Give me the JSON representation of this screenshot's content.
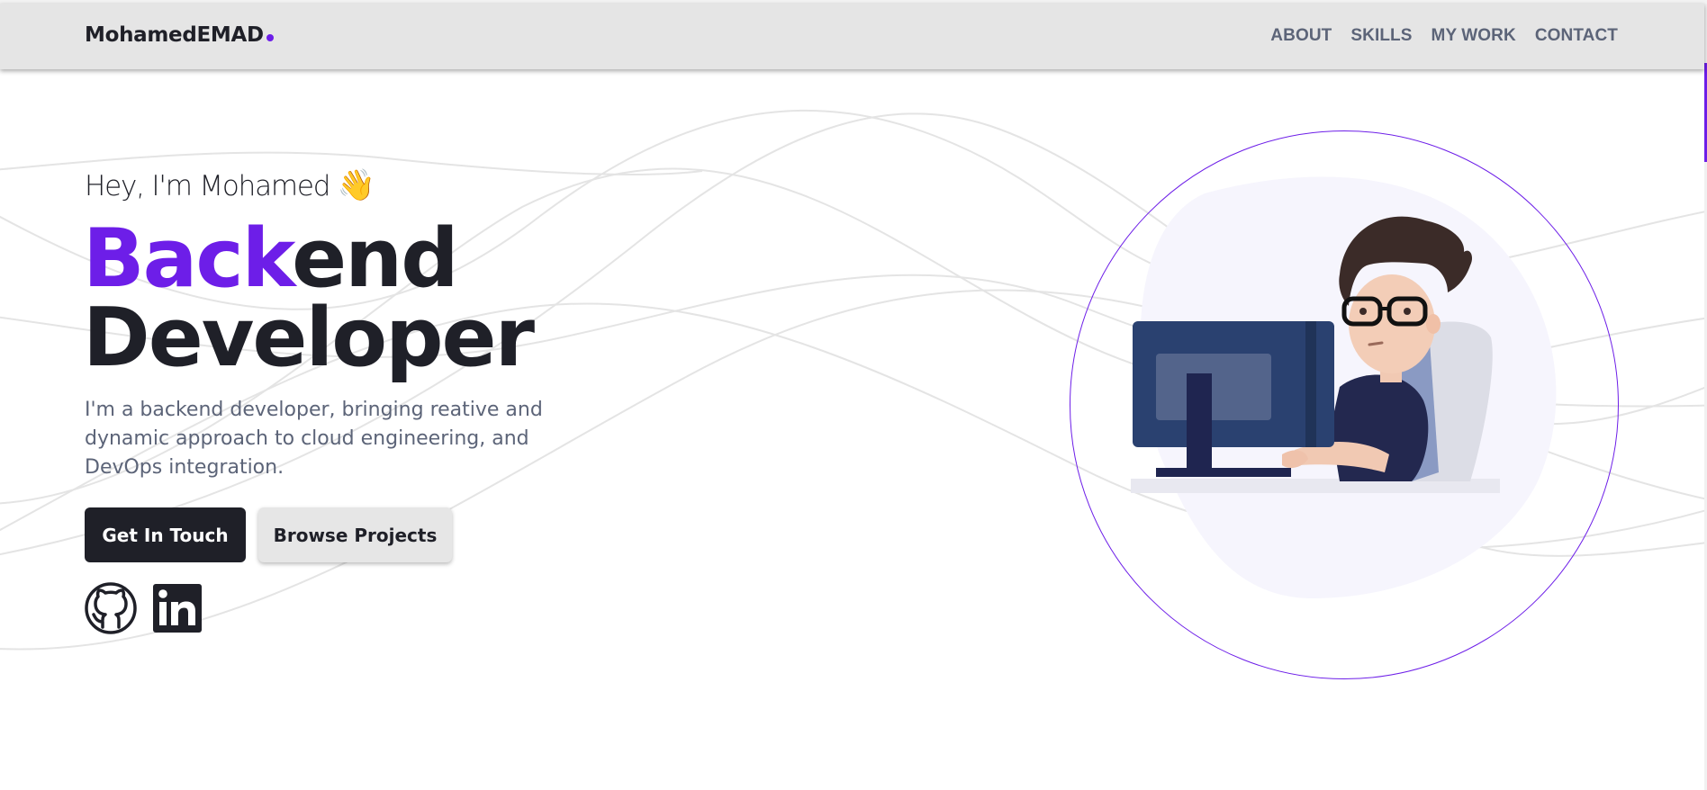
{
  "header": {
    "logo": "MohamedEMAD",
    "nav": [
      "ABOUT",
      "SKILLS",
      "MY WORK",
      "CONTACT"
    ]
  },
  "hero": {
    "greeting": "Hey, I'm Mohamed",
    "greeting_emoji": "👋",
    "title_accent": "Back",
    "title_rest": "end",
    "title_line2": "Developer",
    "intro": "I'm a backend developer, bringing reative and dynamic approach to cloud engineering, and DevOps integration.",
    "primary_button": "Get In Touch",
    "secondary_button": "Browse Projects",
    "social_icons": [
      "github-icon",
      "linkedin-icon"
    ]
  },
  "colors": {
    "accent": "#6d1ee8",
    "dark": "#1f2028",
    "muted": "#5c6478",
    "header_bg": "#e5e5e5"
  }
}
